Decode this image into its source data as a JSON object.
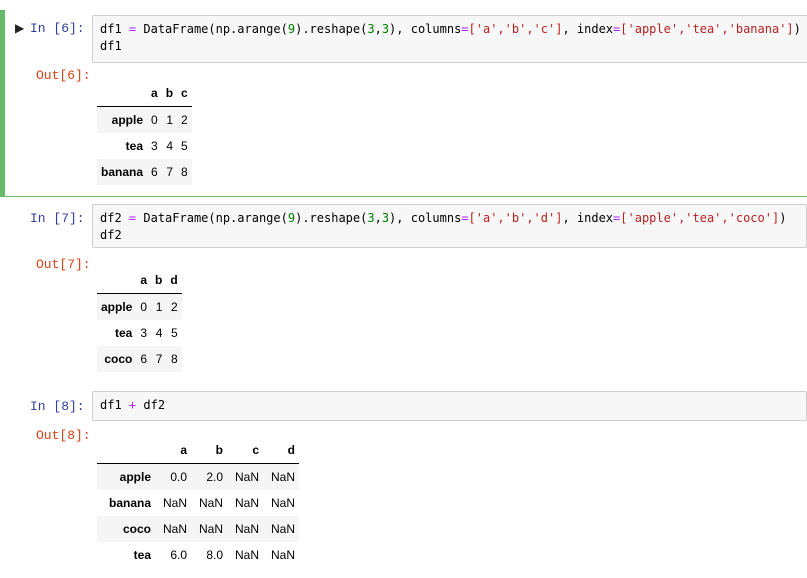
{
  "cells": [
    {
      "in_prompt": "In  [6]:",
      "code_line1_a": "df1 ",
      "code_eq": "=",
      "code_line1_b": " DataFrame(np.arange(",
      "code_num1": "9",
      "code_line1_c": ").reshape(",
      "code_num2": "3",
      "code_comma": ",",
      "code_num3": "3",
      "code_line1_d": "), columns",
      "code_eq2": "=",
      "code_cols": "['a','b','c']",
      "code_line1_e": ", index",
      "code_eq3": "=",
      "code_idx": "['apple','tea','banana']",
      "code_line1_f": ")",
      "code_line2": "df1",
      "out_prompt": "Out[6]:",
      "table": {
        "columns": [
          "a",
          "b",
          "c"
        ],
        "rows": [
          {
            "index": "apple",
            "values": [
              "0",
              "1",
              "2"
            ]
          },
          {
            "index": "tea",
            "values": [
              "3",
              "4",
              "5"
            ]
          },
          {
            "index": "banana",
            "values": [
              "6",
              "7",
              "8"
            ]
          }
        ]
      }
    },
    {
      "in_prompt": "In  [7]:",
      "code_line1_a": "df2 ",
      "code_eq": "=",
      "code_line1_b": " DataFrame(np.arange(",
      "code_num1": "9",
      "code_line1_c": ").reshape(",
      "code_num2": "3",
      "code_comma": ",",
      "code_num3": "3",
      "code_line1_d": "), columns",
      "code_eq2": "=",
      "code_cols": "['a','b','d']",
      "code_line1_e": ", index",
      "code_eq3": "=",
      "code_idx": "['apple','tea','coco']",
      "code_line1_f": ")",
      "code_line2": "df2",
      "out_prompt": "Out[7]:",
      "table": {
        "columns": [
          "a",
          "b",
          "d"
        ],
        "rows": [
          {
            "index": "apple",
            "values": [
              "0",
              "1",
              "2"
            ]
          },
          {
            "index": "tea",
            "values": [
              "3",
              "4",
              "5"
            ]
          },
          {
            "index": "coco",
            "values": [
              "6",
              "7",
              "8"
            ]
          }
        ]
      }
    },
    {
      "in_prompt": "In  [8]:",
      "code_a": "df1 ",
      "code_plus": "+",
      "code_b": " df2",
      "out_prompt": "Out[8]:",
      "table": {
        "columns": [
          "a",
          "b",
          "c",
          "d"
        ],
        "rows": [
          {
            "index": "apple",
            "values": [
              "0.0",
              "2.0",
              "NaN",
              "NaN"
            ]
          },
          {
            "index": "banana",
            "values": [
              "NaN",
              "NaN",
              "NaN",
              "NaN"
            ]
          },
          {
            "index": "coco",
            "values": [
              "NaN",
              "NaN",
              "NaN",
              "NaN"
            ]
          },
          {
            "index": "tea",
            "values": [
              "6.0",
              "8.0",
              "NaN",
              "NaN"
            ]
          }
        ]
      }
    }
  ],
  "colors": {
    "selected_border": "#66bb6a",
    "in_prompt": "#303f9f",
    "out_prompt": "#d84315"
  },
  "icons": {
    "run": "▶"
  }
}
